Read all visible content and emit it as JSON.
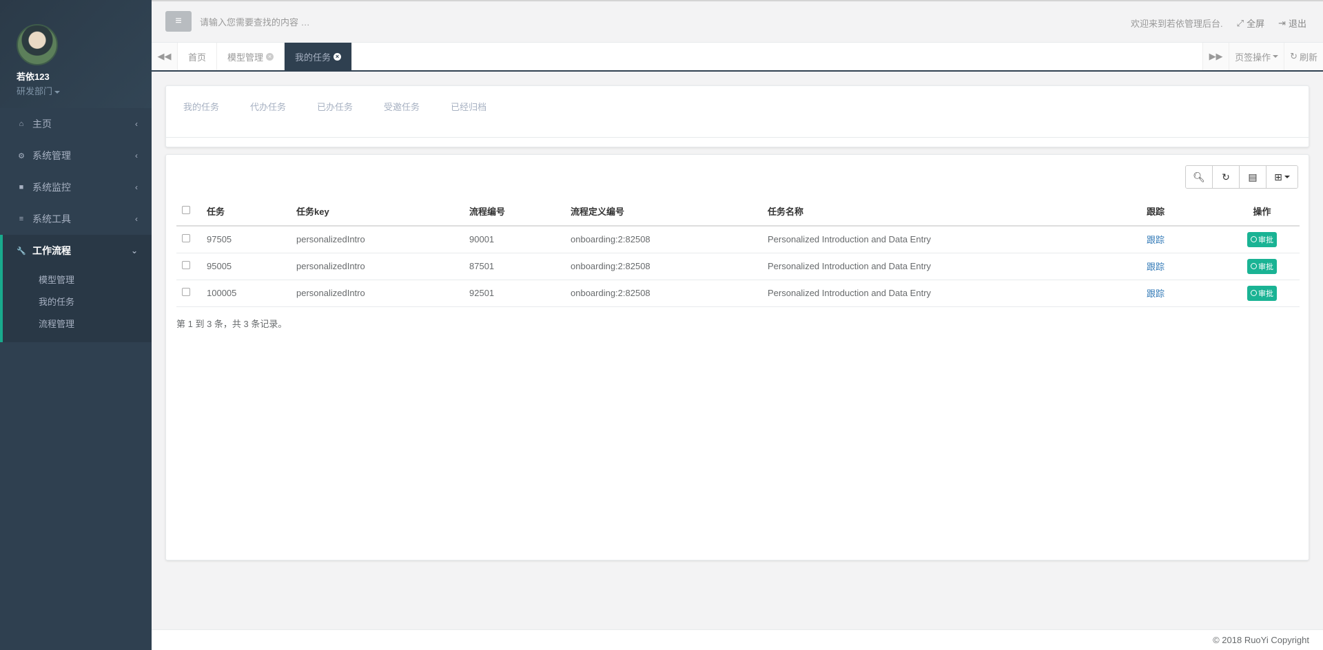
{
  "user": {
    "name": "若依123",
    "department": "研发部门"
  },
  "sidebar": {
    "items": [
      {
        "label": "主页",
        "icon": "home-icon"
      },
      {
        "label": "系统管理",
        "icon": "gear-icon"
      },
      {
        "label": "系统监控",
        "icon": "video-camera-icon"
      },
      {
        "label": "系统工具",
        "icon": "bars-icon"
      },
      {
        "label": "工作流程",
        "icon": "wrench-icon",
        "active": true
      }
    ],
    "subitems": [
      "模型管理",
      "我的任务",
      "流程管理"
    ]
  },
  "header": {
    "search_placeholder": "请输入您需要查找的内容 …",
    "welcome": "欢迎来到若依管理后台.",
    "fullscreen": "全屏",
    "logout": "退出"
  },
  "tabs": {
    "items": [
      "首页",
      "模型管理",
      "我的任务"
    ],
    "active": "我的任务",
    "page_ops": "页签操作",
    "refresh": "刷新"
  },
  "task_tabs": [
    "我的任务",
    "代办任务",
    "已办任务",
    "受邀任务",
    "已经归档"
  ],
  "table": {
    "headers": [
      "任务",
      "任务key",
      "流程编号",
      "流程定义编号",
      "任务名称",
      "跟踪",
      "操作"
    ],
    "rows": [
      {
        "task": "97505",
        "key": "personalizedIntro",
        "proc": "90001",
        "def": "onboarding:2:82508",
        "name": "Personalized Introduction and Data Entry",
        "track": "跟踪",
        "action": "审批"
      },
      {
        "task": "95005",
        "key": "personalizedIntro",
        "proc": "87501",
        "def": "onboarding:2:82508",
        "name": "Personalized Introduction and Data Entry",
        "track": "跟踪",
        "action": "审批"
      },
      {
        "task": "100005",
        "key": "personalizedIntro",
        "proc": "92501",
        "def": "onboarding:2:82508",
        "name": "Personalized Introduction and Data Entry",
        "track": "跟踪",
        "action": "审批"
      }
    ]
  },
  "pagination_info": "第 1 到 3 条，共 3 条记录。",
  "footer": "© 2018 RuoYi Copyright",
  "colors": {
    "sidebar": "#2f4050",
    "accent": "#1ab394",
    "link": "#337ab7"
  }
}
